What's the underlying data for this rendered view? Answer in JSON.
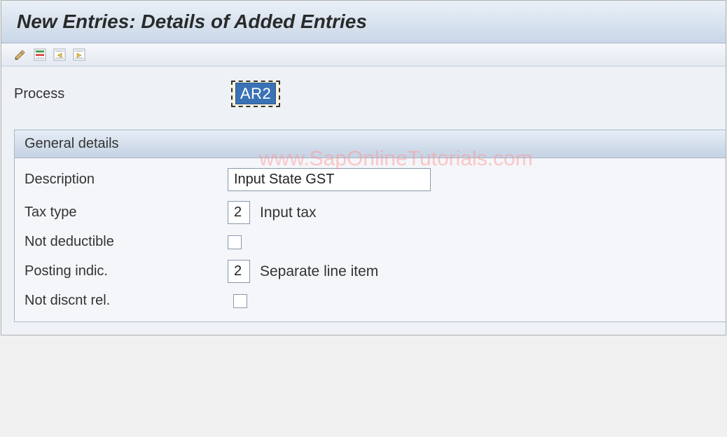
{
  "window": {
    "title": "New Entries: Details of Added Entries"
  },
  "toolbar": {
    "icons": [
      "edit-pencil-icon",
      "delete-row-icon",
      "previous-entry-icon",
      "next-entry-icon"
    ]
  },
  "process": {
    "label": "Process",
    "value": "AR2"
  },
  "group": {
    "title": "General details"
  },
  "fields": {
    "description": {
      "label": "Description",
      "value": "Input State GST"
    },
    "tax_type": {
      "label": "Tax type",
      "value": "2",
      "text": "Input tax"
    },
    "not_deductible": {
      "label": "Not deductible",
      "checked": false
    },
    "posting_indic": {
      "label": "Posting indic.",
      "value": "2",
      "text": "Separate line item"
    },
    "not_discnt_rel": {
      "label": "Not discnt rel.",
      "checked": false
    }
  },
  "watermark": "www.SapOnlineTutorials.com"
}
